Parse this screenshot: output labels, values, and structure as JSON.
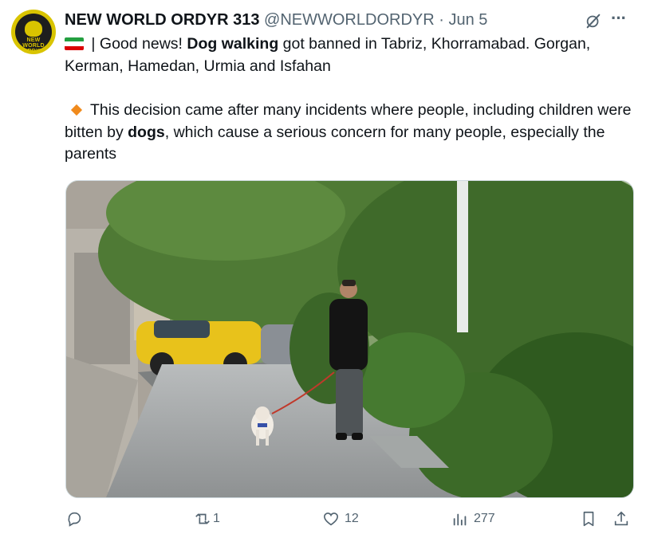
{
  "tweet": {
    "author_name": "NEW WORLD ORDYR 313",
    "author_handle": "@NEWWORLDORDYR",
    "separator": "·",
    "date": "Jun 5",
    "avatar_text": "NEW WORLD ORDYR",
    "flag_icon": "iran-flag-icon",
    "line1_a": " | Good news! ",
    "line1_bold": "Dog walking",
    "line1_b": " got banned in Tabriz, Khorramabad. Gorgan, Kerman, Hamedan, Urmia and Isfahan",
    "line2_a": "This decision came after many incidents where people, including children were bitten by ",
    "line2_bold": "dogs",
    "line2_b": ", which cause a serious concern for many people, especially the parents",
    "bullet_icon": "orange-diamond-icon",
    "media_description_icon": "photo-man-walking-dog-on-wet-sidewalk"
  },
  "actions": {
    "reply_count": "",
    "retweet_count": "1",
    "like_count": "12",
    "views_count": "277"
  },
  "colors": {
    "text": "#0f1419",
    "secondary": "#536471",
    "bullet": "#f08a1c",
    "border": "#cfd9de"
  }
}
